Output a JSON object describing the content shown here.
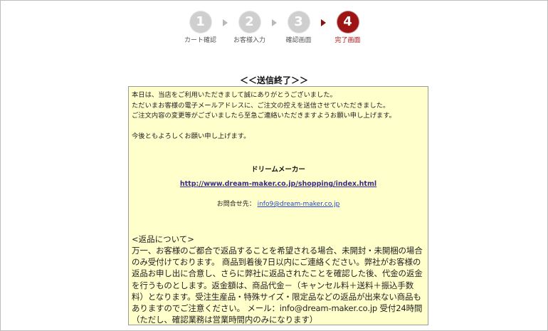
{
  "steps": [
    {
      "number": "1",
      "label": "カート確認",
      "active": false
    },
    {
      "number": "2",
      "label": "お客様入力",
      "active": false
    },
    {
      "number": "3",
      "label": "確認画面",
      "active": false
    },
    {
      "number": "4",
      "label": "完了画面",
      "active": true
    }
  ],
  "title": "＜＜送信終了＞＞",
  "message": {
    "line1": "本日は、当店をご利用いただきまして誠にありがとうございました。",
    "line2": "ただいまお客様の電子メールアドレスに、ご注文の控えを送信させていただきました。",
    "line3": "ご注文内容の変更等がございましたら至急ご連絡いただきますようお願い申し上げます。",
    "line4": "今後ともよろしくお願い申し上げます。"
  },
  "shop": {
    "name": "ドリームメーカー",
    "url": "http://www.dream-maker.co.jp/shopping/index.html",
    "contact_label": "お問合せ先：",
    "contact_email": "info9@dream-maker.co.jp"
  },
  "returns": {
    "heading": "<返品について>",
    "body": "万一、お客様のご都合で返品することを希望される場合、未開封・未開梱の場合のみ受付けております。 商品到着後7日以内にご連絡ください。弊社がお客様の返品お申し出に合意し、さらに弊社に返品されたことを確認した後、代金の返金を行うものとします。返金額は、商品代金－（キャンセル料＋送料＋振込手数料）となります。受注生産品・特殊サイズ・限定品などの返品が出来ない商品もありますのでご注意ください。 メール：info@dream-maker.co.jp 受付24時間（ただし、確認業務は営業時間内のみになります）"
  }
}
